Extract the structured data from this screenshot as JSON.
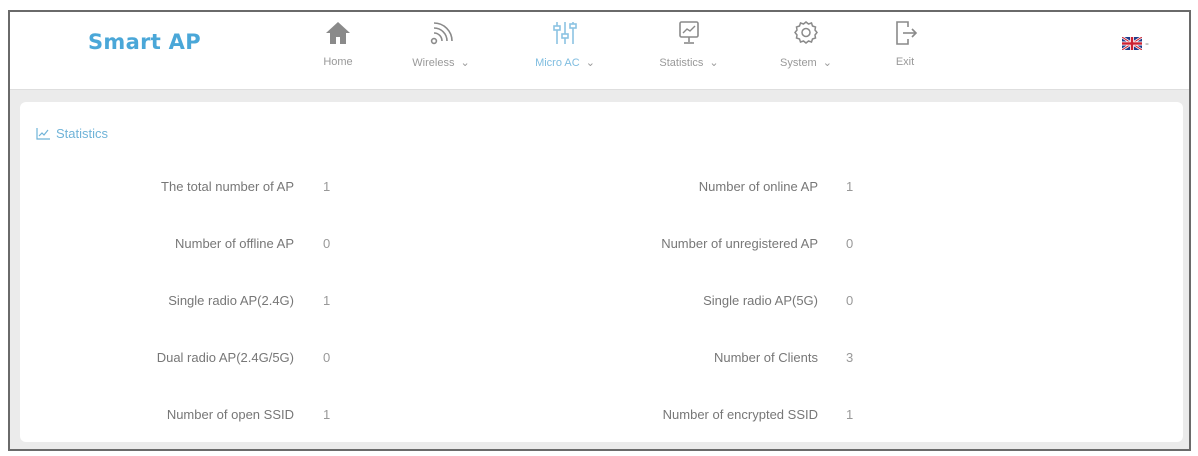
{
  "header": {
    "brand": "Smart AP",
    "nav": [
      {
        "label": "Home",
        "icon": "home-icon",
        "caret": ""
      },
      {
        "label": "Wireless",
        "icon": "wifi-icon",
        "caret": "⌄"
      },
      {
        "label": "Micro AC",
        "icon": "sliders-icon",
        "caret": "⌄",
        "active": true
      },
      {
        "label": "Statistics",
        "icon": "monitor-icon",
        "caret": "⌄"
      },
      {
        "label": "System",
        "icon": "gear-icon",
        "caret": "⌄"
      },
      {
        "label": "Exit",
        "icon": "exit-icon",
        "caret": ""
      }
    ],
    "language": {
      "icon": "uk-flag-icon",
      "caret": "-"
    }
  },
  "statistics": {
    "title": "Statistics",
    "left": [
      {
        "label": "The total number of AP",
        "value": "1"
      },
      {
        "label": "Number of offline AP",
        "value": "0"
      },
      {
        "label": "Single radio AP(2.4G)",
        "value": "1"
      },
      {
        "label": "Dual radio AP(2.4G/5G)",
        "value": "0"
      },
      {
        "label": "Number of open SSID",
        "value": "1"
      }
    ],
    "right": [
      {
        "label": "Number of online AP",
        "value": "1"
      },
      {
        "label": "Number of unregistered AP",
        "value": "0"
      },
      {
        "label": "Single radio AP(5G)",
        "value": "0"
      },
      {
        "label": "Number of Clients",
        "value": "3"
      },
      {
        "label": "Number of encrypted SSID",
        "value": "1"
      }
    ]
  },
  "colors": {
    "brand": "#4aa7d8",
    "active_nav": "#7fbde0",
    "page_bg": "#ebebeb",
    "card_bg": "#ffffff"
  }
}
